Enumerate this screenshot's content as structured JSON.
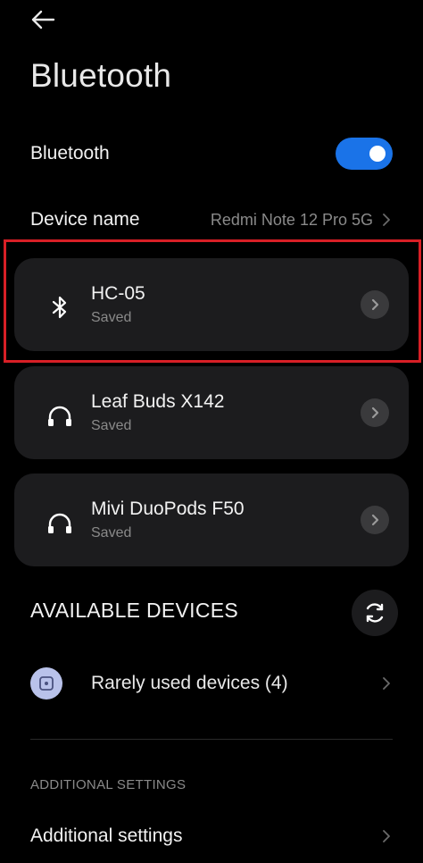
{
  "header": {
    "title": "Bluetooth",
    "back_icon": "arrow-left-icon"
  },
  "bluetooth_toggle": {
    "label": "Bluetooth",
    "on": true,
    "accent_color": "#1a73e8"
  },
  "device_name": {
    "label": "Device name",
    "value": "Redmi Note 12 Pro 5G"
  },
  "saved_devices": [
    {
      "name": "HC-05",
      "status": "Saved",
      "icon": "bluetooth-icon",
      "highlighted": true
    },
    {
      "name": "Leaf Buds X142",
      "status": "Saved",
      "icon": "headphones-icon",
      "highlighted": false
    },
    {
      "name": "Mivi DuoPods F50",
      "status": "Saved",
      "icon": "headphones-icon",
      "highlighted": false
    }
  ],
  "available_devices": {
    "header": "AVAILABLE DEVICES",
    "refresh_icon": "refresh-icon",
    "rarely_used_label": "Rarely used devices (4)"
  },
  "additional": {
    "section_caption": "ADDITIONAL SETTINGS",
    "label": "Additional settings"
  },
  "colors": {
    "background": "#000000",
    "card": "#1c1c1e",
    "highlight_border": "#d81f26",
    "secondary_text": "#8a8a8a"
  }
}
